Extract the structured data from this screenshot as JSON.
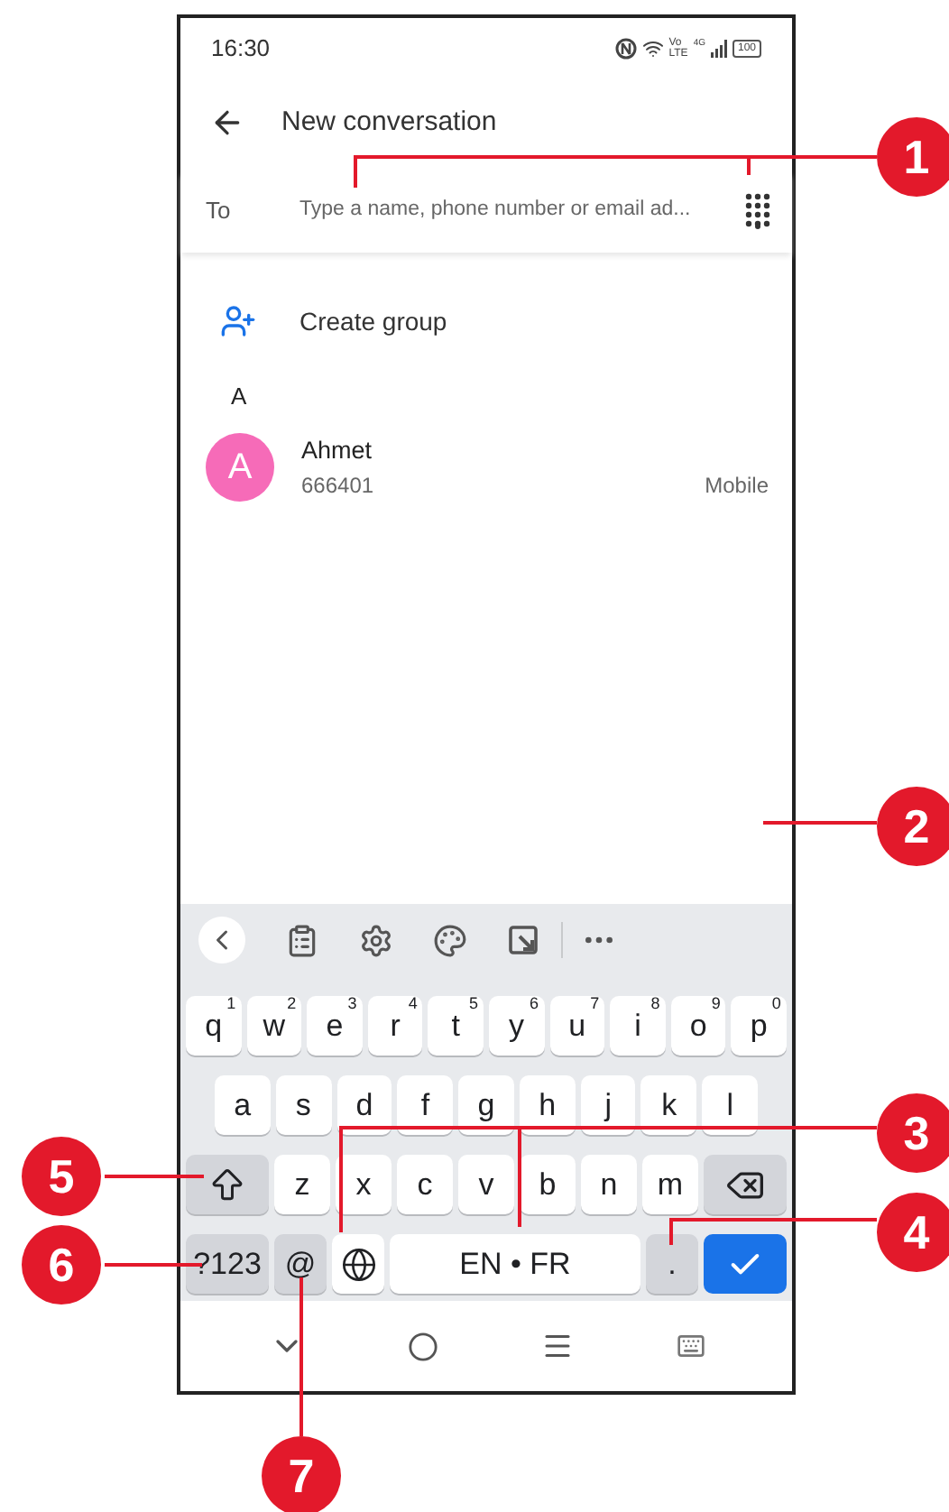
{
  "status_bar": {
    "time": "16:30",
    "volte_top": "Vo",
    "volte_bottom": "LTE",
    "network": "4G",
    "battery": "100"
  },
  "header": {
    "title": "New conversation"
  },
  "to_field": {
    "label": "To",
    "placeholder": "Type a name, phone number or email ad..."
  },
  "create_group": {
    "label": "Create group"
  },
  "section": {
    "letter": "A"
  },
  "contacts": [
    {
      "initial": "A",
      "name": "Ahmet",
      "number": "666401",
      "type": "Mobile",
      "color": "#f66bb8"
    }
  ],
  "keyboard": {
    "letter_rows": [
      [
        {
          "kind": "letter",
          "label": "q",
          "hint": "1"
        },
        {
          "kind": "letter",
          "label": "w",
          "hint": "2"
        },
        {
          "kind": "letter",
          "label": "e",
          "hint": "3"
        },
        {
          "kind": "letter",
          "label": "r",
          "hint": "4"
        },
        {
          "kind": "letter",
          "label": "t",
          "hint": "5"
        },
        {
          "kind": "letter",
          "label": "y",
          "hint": "6"
        },
        {
          "kind": "letter",
          "label": "u",
          "hint": "7"
        },
        {
          "kind": "letter",
          "label": "i",
          "hint": "8"
        },
        {
          "kind": "letter",
          "label": "o",
          "hint": "9"
        },
        {
          "kind": "letter",
          "label": "p",
          "hint": "0"
        }
      ],
      [
        {
          "kind": "letter",
          "label": "a"
        },
        {
          "kind": "letter",
          "label": "s"
        },
        {
          "kind": "letter",
          "label": "d"
        },
        {
          "kind": "letter",
          "label": "f"
        },
        {
          "kind": "letter",
          "label": "g"
        },
        {
          "kind": "letter",
          "label": "h"
        },
        {
          "kind": "letter",
          "label": "j"
        },
        {
          "kind": "letter",
          "label": "k"
        },
        {
          "kind": "letter",
          "label": "l"
        }
      ],
      [
        {
          "kind": "shift"
        },
        {
          "kind": "letter",
          "label": "z"
        },
        {
          "kind": "letter",
          "label": "x"
        },
        {
          "kind": "letter",
          "label": "c"
        },
        {
          "kind": "letter",
          "label": "v"
        },
        {
          "kind": "letter",
          "label": "b"
        },
        {
          "kind": "letter",
          "label": "n"
        },
        {
          "kind": "letter",
          "label": "m"
        },
        {
          "kind": "backspace"
        }
      ]
    ],
    "bottom_row": [
      {
        "kind": "symbols",
        "label": "?123"
      },
      {
        "kind": "function",
        "label": "@"
      },
      {
        "kind": "globe"
      },
      {
        "kind": "space",
        "label": "EN • FR"
      },
      {
        "kind": "function",
        "label": "."
      },
      {
        "kind": "enter"
      }
    ]
  },
  "callouts": [
    {
      "number": "1"
    },
    {
      "number": "2"
    },
    {
      "number": "3"
    },
    {
      "number": "4"
    },
    {
      "number": "5"
    },
    {
      "number": "6"
    },
    {
      "number": "7"
    }
  ]
}
